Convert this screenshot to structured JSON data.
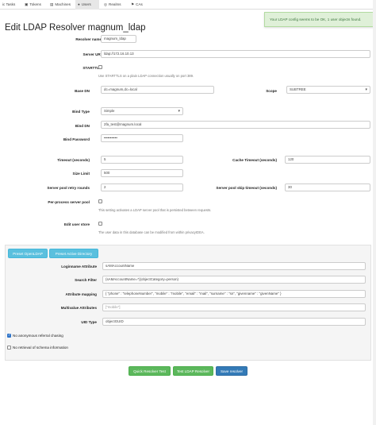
{
  "nav": {
    "tabs": [
      {
        "label": "ic Tasks",
        "icon": "tasks-icon"
      },
      {
        "label": "Tokens",
        "icon": "tokens-icon"
      },
      {
        "label": "Machines",
        "icon": "machines-icon"
      },
      {
        "label": "Users",
        "icon": "user-icon",
        "active": true
      },
      {
        "label": "Realms",
        "icon": "globe-icon"
      },
      {
        "label": "CAs",
        "icon": "bookmark-icon"
      }
    ]
  },
  "notification": "Your LDAP config seems to be OK, 1 user objects found.",
  "page_title": "Edit LDAP Resolver magnum_ldap",
  "form": {
    "resolver_name": {
      "label": "Resolver name",
      "value": "magnum_ldap"
    },
    "server_uri": {
      "label": "Server URI",
      "value": "ldap://172.16.10.13"
    },
    "starttls": {
      "label": "STARTTLS",
      "help": "Use STARTTLS on a plain LDAP connection usually on port 389."
    },
    "base_dn": {
      "label": "Base DN",
      "value": "dc=magnum,dc=local"
    },
    "scope": {
      "label": "Scope",
      "value": "SUBTREE"
    },
    "bind_type": {
      "label": "Bind Type",
      "value": "Simple"
    },
    "bind_dn": {
      "label": "Bind DN",
      "value": "2fa_test@magnum.local"
    },
    "bind_password": {
      "label": "Bind Password",
      "value": "•••••••••••"
    },
    "timeout": {
      "label": "Timeout (seconds)",
      "value": "5"
    },
    "cache_timeout": {
      "label": "Cache Timeout (seconds)",
      "value": "120"
    },
    "size_limit": {
      "label": "Size Limit",
      "value": "500"
    },
    "retry_rounds": {
      "label": "Server pool retry rounds",
      "value": "2"
    },
    "skip_timeout": {
      "label": "Server pool skip timeout (seconds)",
      "value": "30"
    },
    "per_process": {
      "label": "Per-process server pool",
      "help": "This setting activates a LDAP server pool that is persisted between requests."
    },
    "edit_user_store": {
      "label": "Edit user store",
      "help": "The user data in this database can be modified from within privacyIDEA."
    }
  },
  "panel": {
    "preset_openldap": "Preset OpenLDAP",
    "preset_ad": "Preset Active Directory",
    "loginname": {
      "label": "Loginname Attribute",
      "value": "sAMAccountName"
    },
    "search_filter": {
      "label": "Search Filter",
      "value": "(sAMAccountName=*)(objectCategory=person)"
    },
    "attribute_mapping": {
      "label": "Attribute mapping",
      "value": "{ \"phone\" : \"telephoneNumber\", \"mobile\" : \"mobile\", \"email\" : \"mail\", \"surname\" : \"sn\", \"givenname\" : \"givenName\" }"
    },
    "multivalue": {
      "label": "Multivalue Attributes",
      "placeholder": "[\"mobile\"]"
    },
    "uid_type": {
      "label": "UID Type",
      "value": "objectGUID"
    },
    "no_referral": {
      "label": "No anonymous referral chasing",
      "checked": true
    },
    "no_schema": {
      "label": "No retrieval of schema information",
      "checked": false
    }
  },
  "actions": {
    "quick_test": "Quick Resolver Test",
    "ldap_test": "Test LDAP Resolver",
    "save": "Save resolver"
  },
  "colors": {
    "info": "#5bc0de",
    "success": "#5cb85c",
    "primary": "#337ab7",
    "alert_bg": "#dff0d8"
  }
}
